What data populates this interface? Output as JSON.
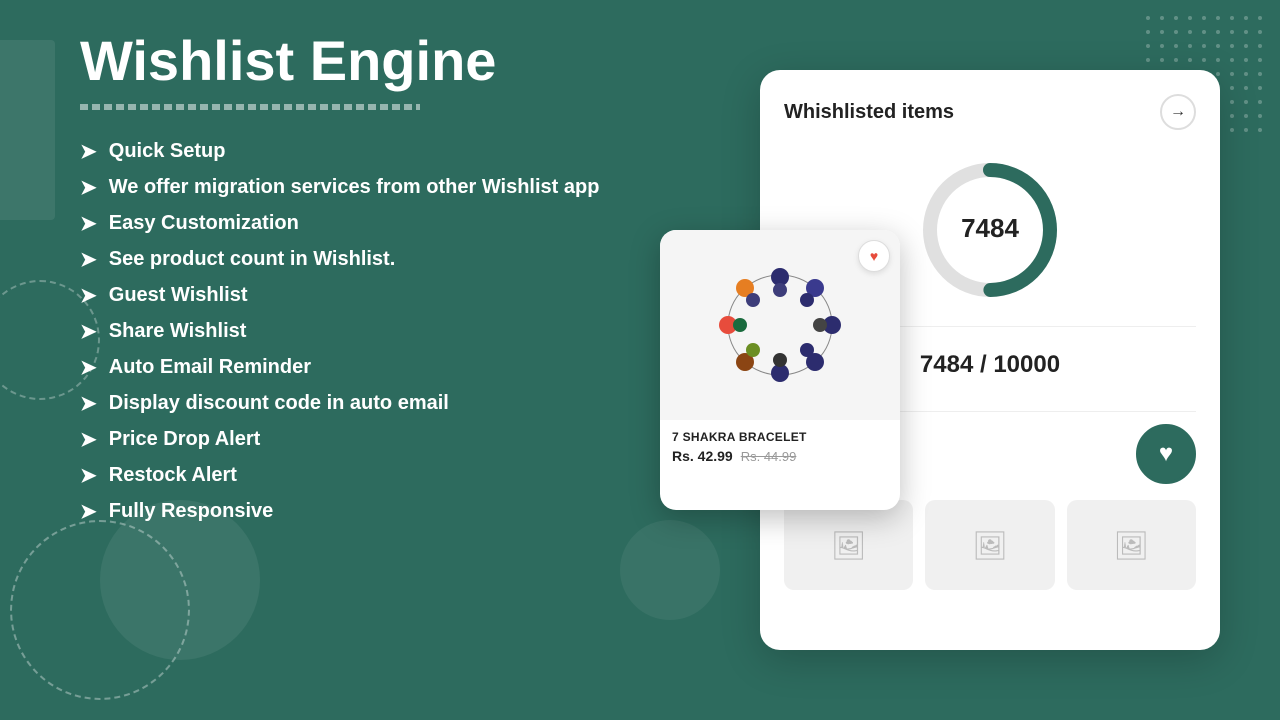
{
  "page": {
    "background_color": "#2d6b5e",
    "title": "Wishlist Engine",
    "title_underline": true
  },
  "features": {
    "items": [
      {
        "id": "quick-setup",
        "text": "Quick Setup"
      },
      {
        "id": "migration",
        "text": "We offer migration services from other Wishlist app"
      },
      {
        "id": "customization",
        "text": "Easy Customization"
      },
      {
        "id": "product-count",
        "text": "See product count in Wishlist."
      },
      {
        "id": "guest-wishlist",
        "text": "Guest Wishlist"
      },
      {
        "id": "share-wishlist",
        "text": "Share Wishlist"
      },
      {
        "id": "auto-email",
        "text": "Auto Email Reminder"
      },
      {
        "id": "discount-code",
        "text": "Display discount code in auto email"
      },
      {
        "id": "price-drop",
        "text": "Price Drop Alert"
      },
      {
        "id": "restock",
        "text": "Restock Alert"
      },
      {
        "id": "responsive",
        "text": "Fully Responsive"
      }
    ],
    "arrow_symbol": "➤"
  },
  "right_panel": {
    "card": {
      "title": "Whishlisted items",
      "arrow_label": "→",
      "donut": {
        "value": 7484,
        "max": 10000,
        "percentage": 74.84,
        "color_active": "#2d6b5e",
        "color_inactive": "#e0e0e0"
      },
      "counter_text": "7484 / 10000",
      "heart_button_label": "♥",
      "placeholder_count": 3
    },
    "product_card": {
      "name": "7 SHAKRA BRACELET",
      "price_current": "Rs. 42.99",
      "price_original": "Rs. 44.99",
      "heart_icon": "♥"
    }
  }
}
